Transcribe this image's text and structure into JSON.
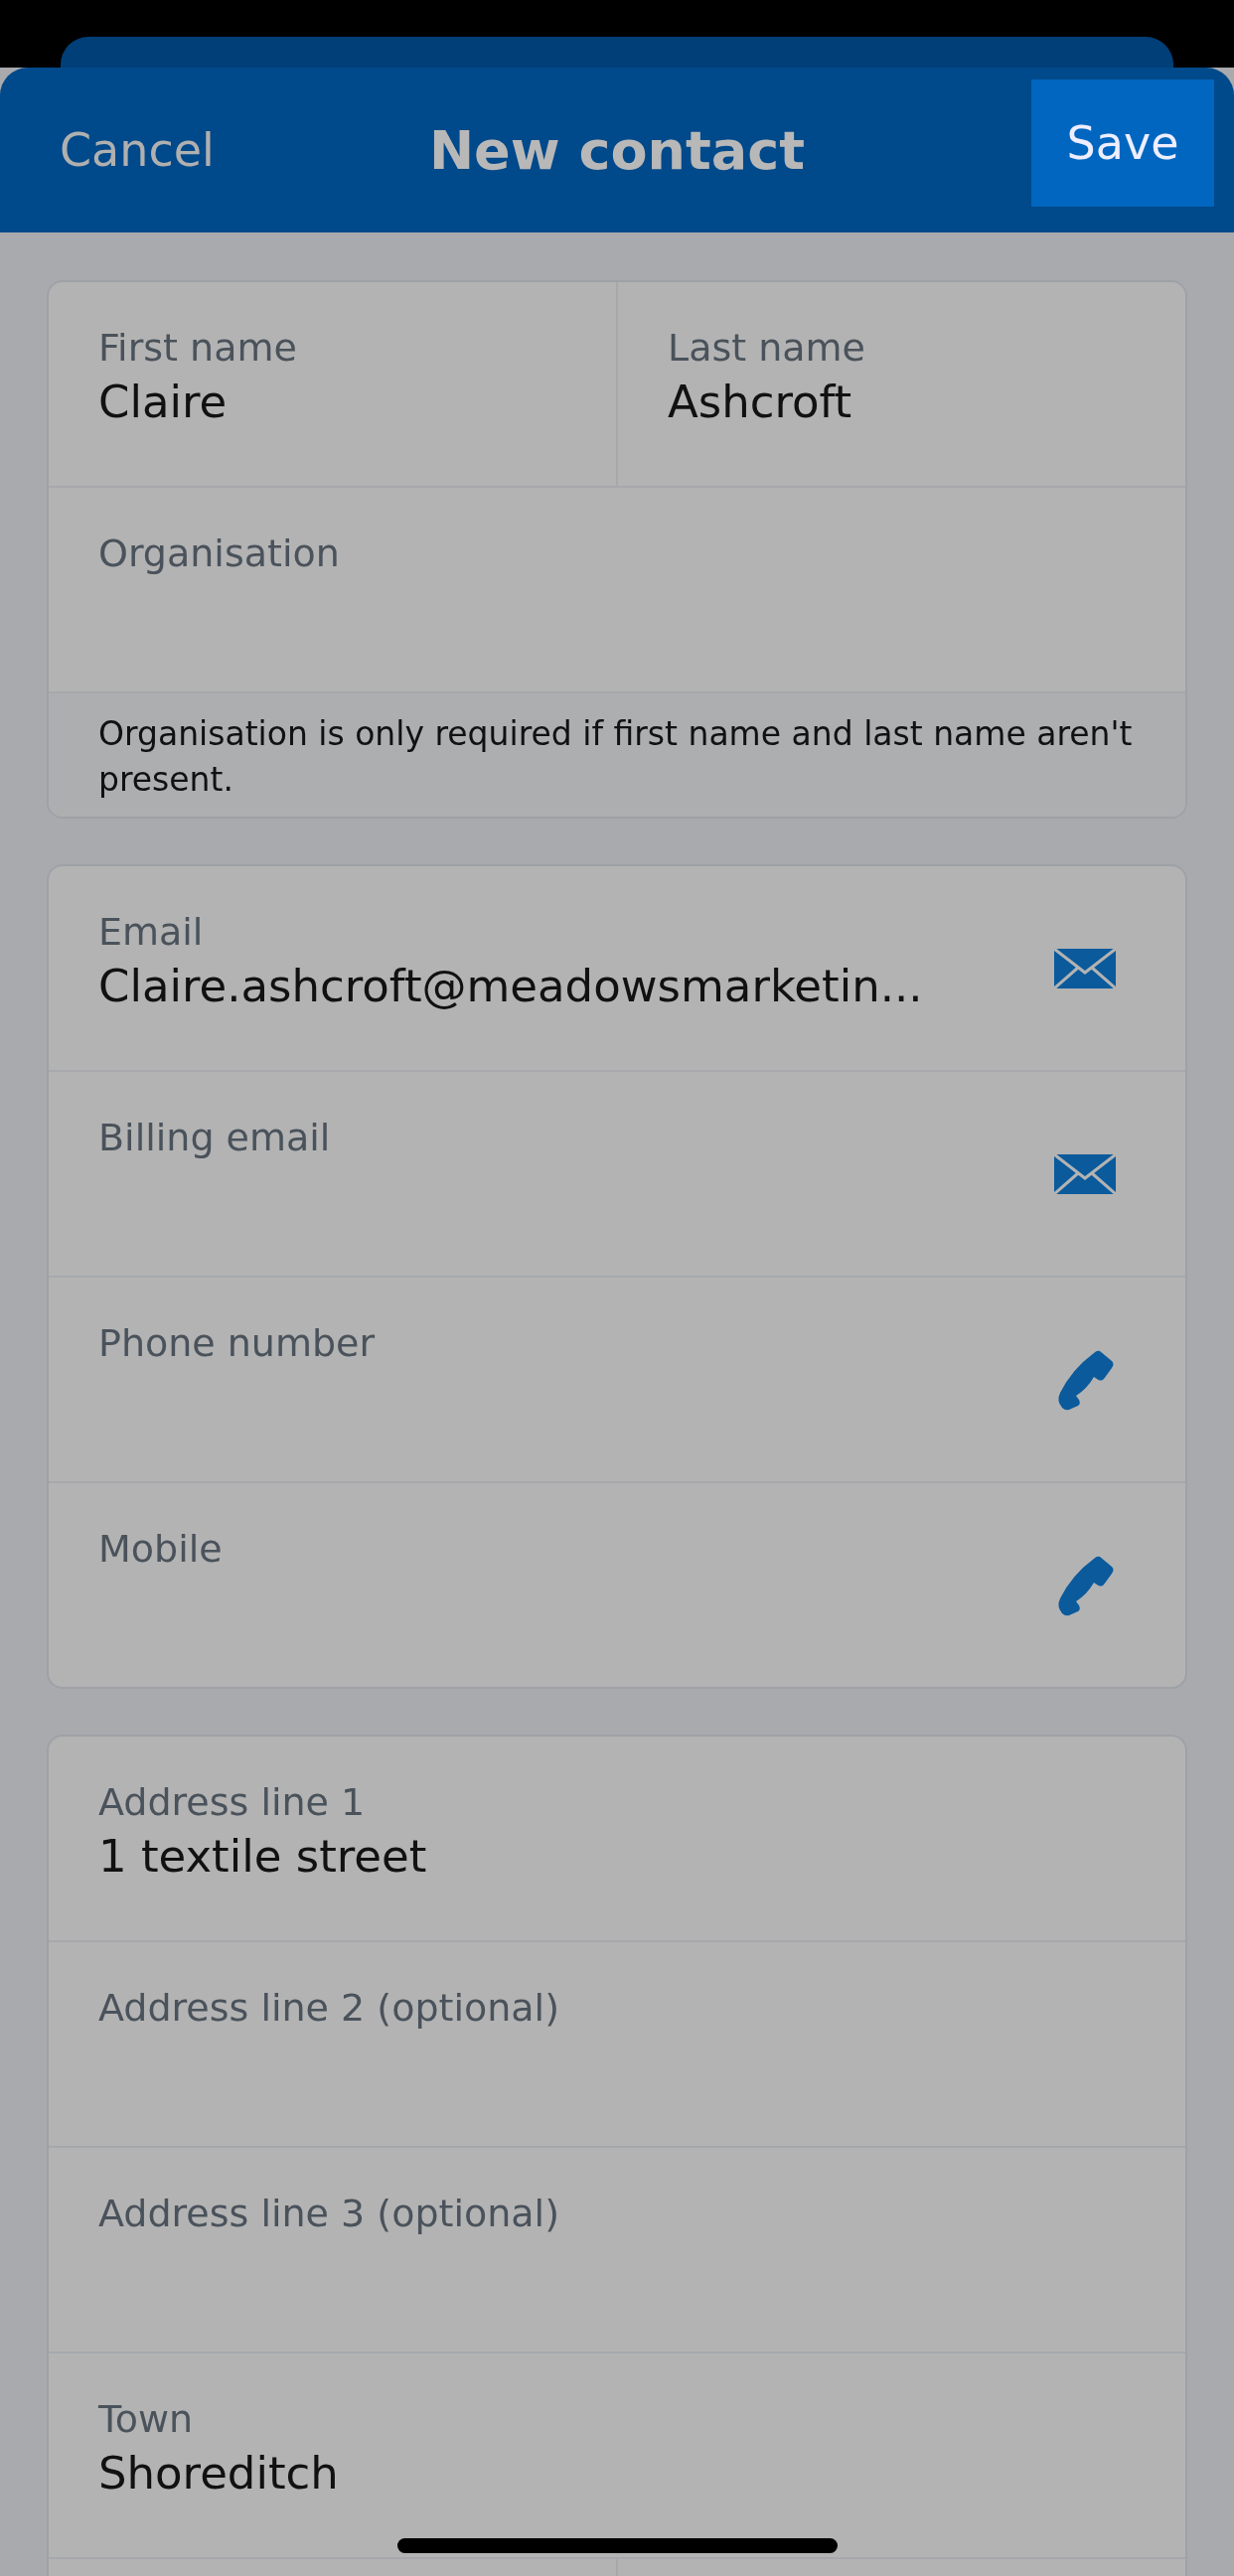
{
  "header": {
    "cancel": "Cancel",
    "title": "New contact",
    "save": "Save"
  },
  "sections": [
    {
      "rows": [
        {
          "kind": "pair",
          "fields": [
            {
              "label": "First name",
              "value": "Claire"
            },
            {
              "label": "Last name",
              "value": "Ashcroft"
            }
          ]
        },
        {
          "kind": "field",
          "label": "Organisation"
        },
        {
          "kind": "note",
          "text": "Organisation is only required if first name and last name aren't present."
        }
      ]
    },
    {
      "rows": [
        {
          "kind": "email",
          "label": "Email",
          "value": "Claire.ashcroft@meadowsmarketin..."
        },
        {
          "kind": "email",
          "label": "Billing email"
        },
        {
          "kind": "phone",
          "label": "Phone number"
        },
        {
          "kind": "phone",
          "label": "Mobile"
        }
      ]
    },
    {
      "rows": [
        {
          "kind": "field",
          "label": "Address line 1",
          "value": "1 textile street"
        },
        {
          "kind": "field",
          "label": "Address line 2 (optional)"
        },
        {
          "kind": "field",
          "label": "Address line 3 (optional)"
        },
        {
          "kind": "field",
          "label": "Town",
          "value": "Shoreditch"
        },
        {
          "kind": "split"
        }
      ]
    }
  ]
}
